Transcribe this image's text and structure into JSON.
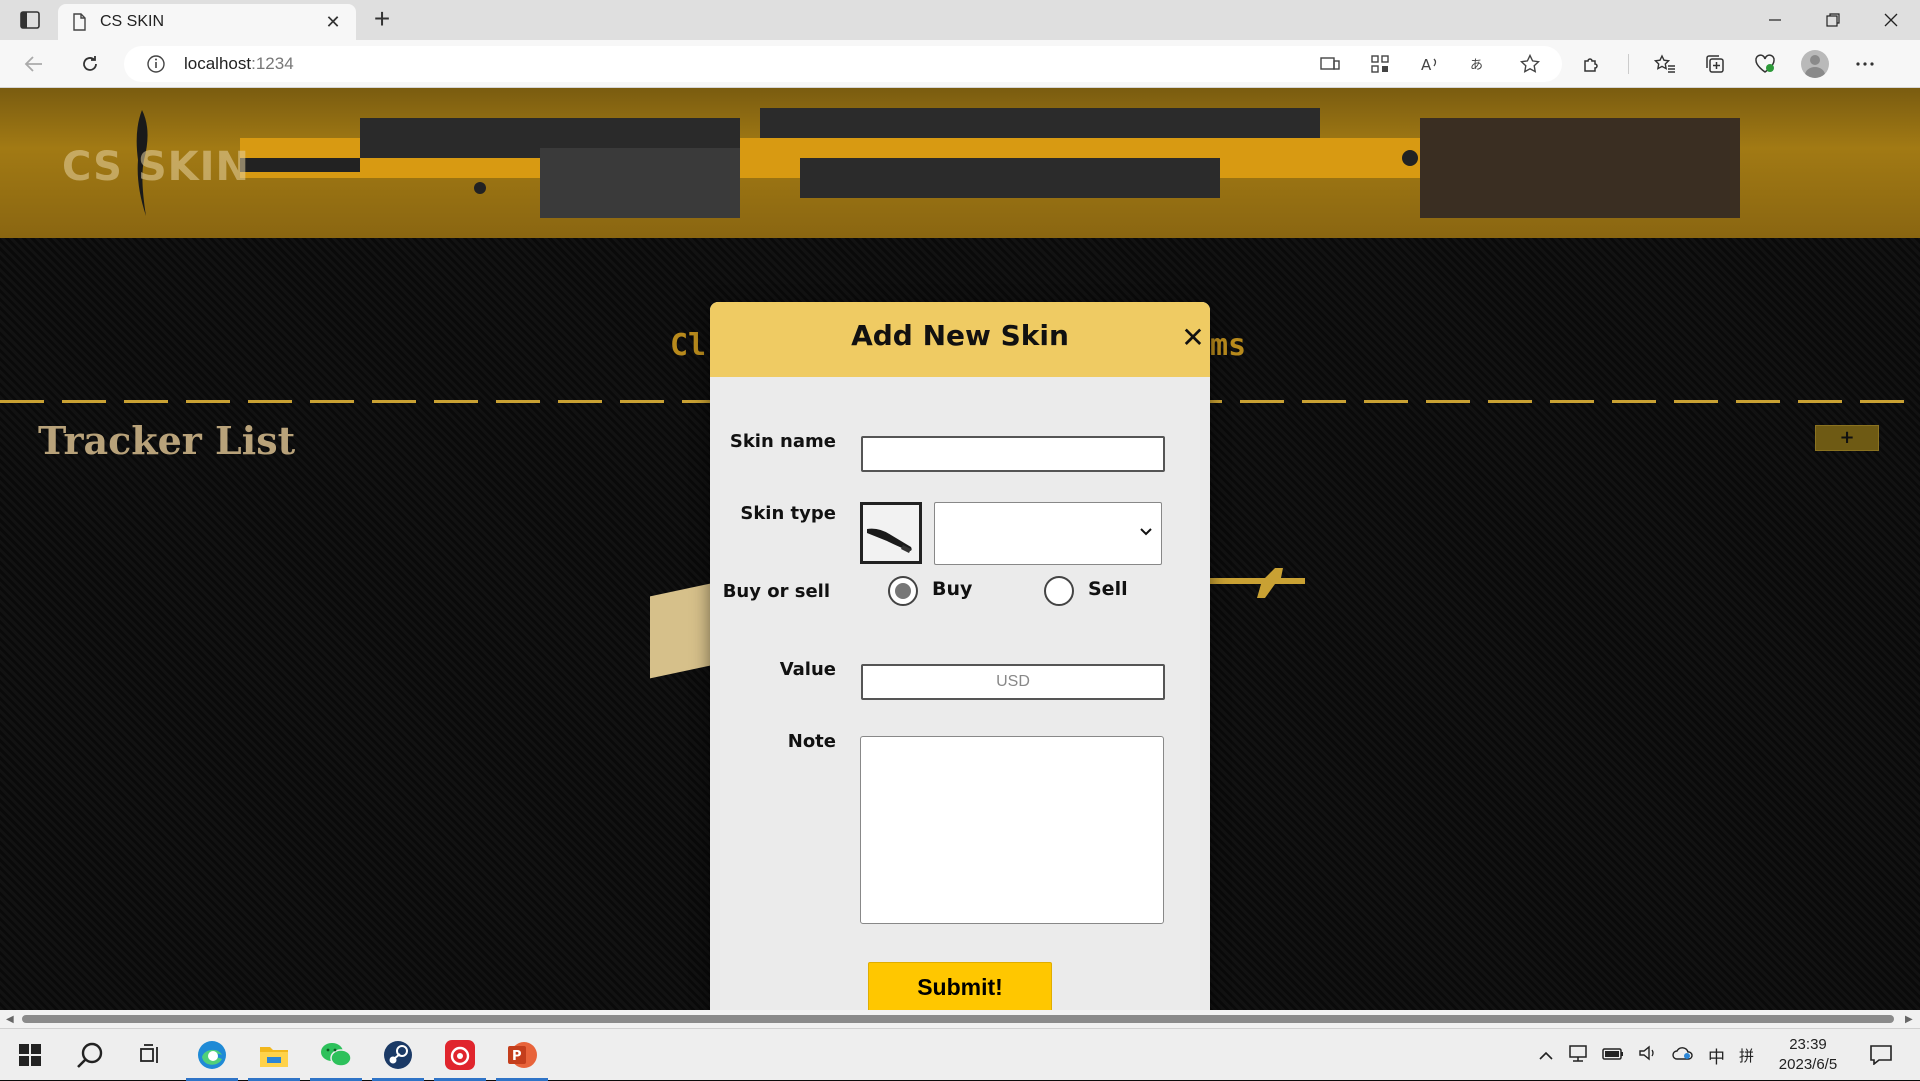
{
  "browser": {
    "tab_title": "CS SKIN",
    "url_host": "localhost",
    "url_port": ":1234"
  },
  "page": {
    "logo_text": "CS SKIN",
    "tracker_title": "Tracker List",
    "add_button_label": "+"
  },
  "modal": {
    "title": "Add New Skin",
    "close_label": "✕",
    "skin_name_label": "Skin name",
    "skin_name_value": "",
    "skin_type_label": "Skin type",
    "skin_type_value": "",
    "buy_sell_label": "Buy or sell",
    "buy_label": "Buy",
    "sell_label": "Sell",
    "selected_option": "Buy",
    "value_label": "Value",
    "value_placeholder": "USD",
    "note_label": "Note",
    "note_value": "",
    "submit_label": "Submit!"
  },
  "taskbar": {
    "time": "23:39",
    "date": "2023/6/5",
    "ime_lang": "中",
    "ime_mode": "拼"
  },
  "colors": {
    "modal_header": "#efcb63",
    "submit": "#ffc700",
    "banner": "#a27a14",
    "accent_dash": "#c9a133"
  }
}
